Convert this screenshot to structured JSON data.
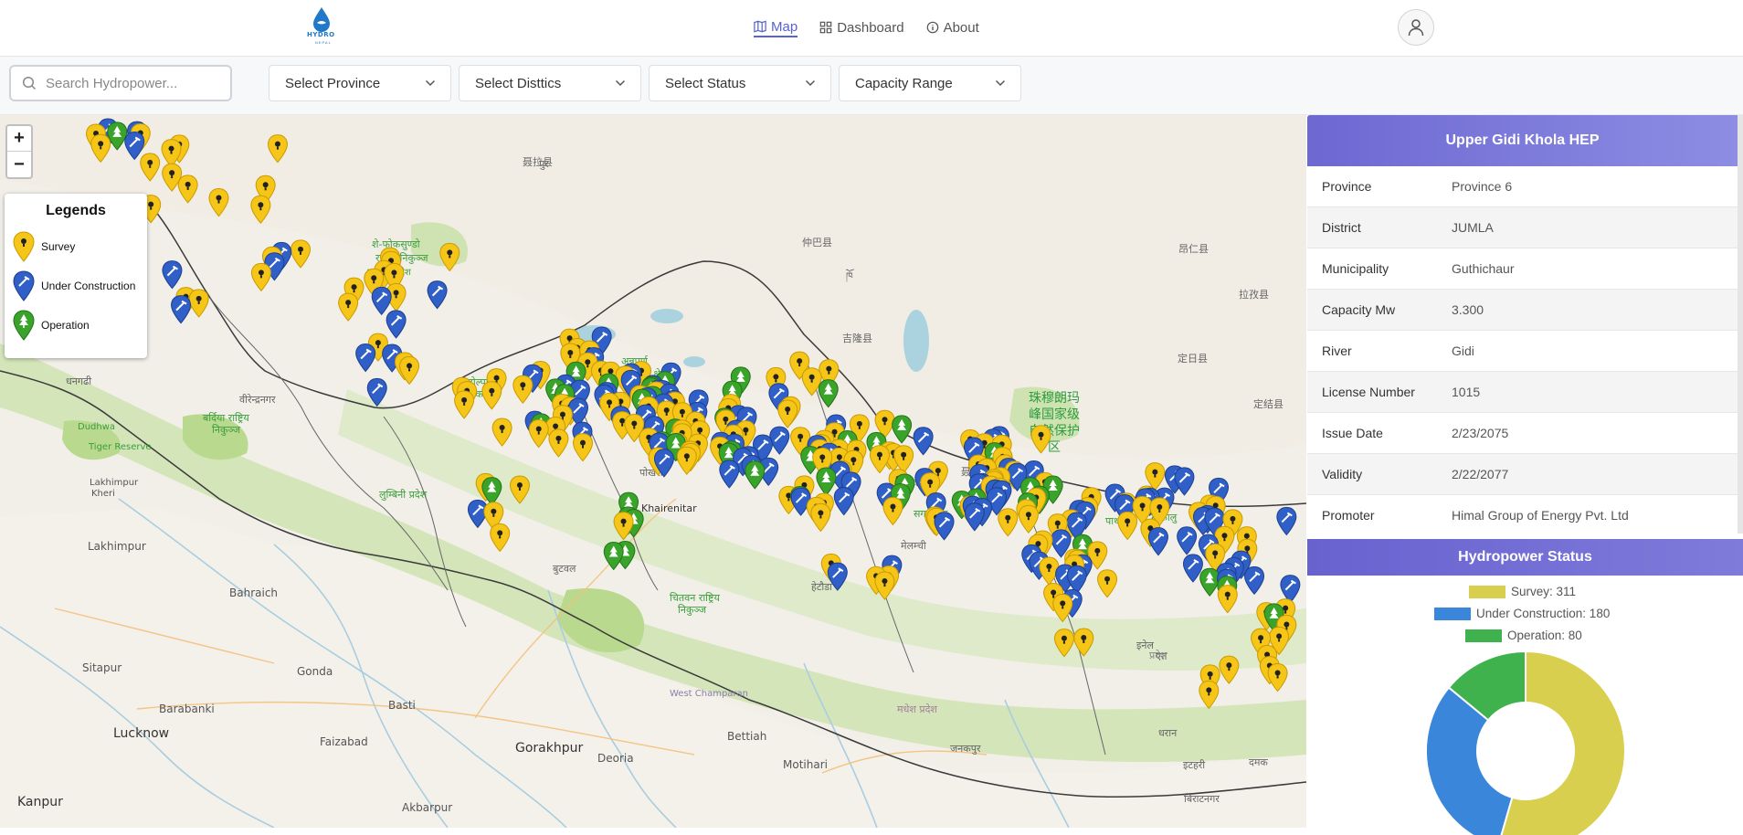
{
  "header": {
    "logo_text": "HYDRO",
    "logo_sub": "NEPAL",
    "nav": [
      {
        "label": "Map",
        "active": true
      },
      {
        "label": "Dashboard",
        "active": false
      },
      {
        "label": "About",
        "active": false
      }
    ]
  },
  "filters": {
    "search_placeholder": "Search Hydropower...",
    "province": "Select Province",
    "districts": "Select Disttics",
    "status": "Select Status",
    "capacity": "Capacity Range"
  },
  "map": {
    "zoom_in": "+",
    "zoom_out": "−",
    "legend": {
      "title": "Legends",
      "items": [
        {
          "label": "Survey",
          "color": "#f5c518"
        },
        {
          "label": "Under Construction",
          "color": "#2f5fc7"
        },
        {
          "label": "Operation",
          "color": "#3aa32a"
        }
      ]
    },
    "labels": {
      "lucknow": "Lucknow",
      "kanpur": "Kanpur",
      "gorakhpur": "Gorakhpur",
      "bettiah": "Bettiah",
      "west_champaran": "West Champaran",
      "lakhimpur": "Lakhimpur",
      "bahraich": "Bahraich",
      "sitapur": "Sitapur",
      "gonda": "Gonda",
      "basti": "Basti",
      "faizabad": "Faizabad",
      "barabanki": "Barabanki",
      "deoria": "Deoria",
      "motihari": "Motihari",
      "akbarpur": "Akbarpur",
      "reserve_cn": "珠穆朗玛\n峰国家级\n自然保护\n区",
      "dudhwa": "Dudhwa\nTiger Reserve",
      "khairenitar": "Khairenitar",
      "lakhimpur_kheri": "Lakhimpur\nKheri"
    }
  },
  "details": {
    "title": "Upper Gidi Khola HEP",
    "rows": [
      {
        "key": "Province",
        "value": "Province 6"
      },
      {
        "key": "District",
        "value": "JUMLA"
      },
      {
        "key": "Municipality",
        "value": "Guthichaur"
      },
      {
        "key": "Capacity Mw",
        "value": "3.300"
      },
      {
        "key": "River",
        "value": "Gidi"
      },
      {
        "key": "License Number",
        "value": "1015"
      },
      {
        "key": "Issue Date",
        "value": "2/23/2075"
      },
      {
        "key": "Validity",
        "value": "2/22/2077"
      },
      {
        "key": "Promoter",
        "value": "Himal Group of Energy Pvt. Ltd"
      }
    ]
  },
  "status": {
    "title": "Hydropower Status",
    "legend": [
      {
        "label": "Survey: 311",
        "color": "#d9cf4e"
      },
      {
        "label": "Under Construction: 180",
        "color": "#3a86db"
      },
      {
        "label": "Operation: 80",
        "color": "#3fb14d"
      }
    ],
    "chart_data": {
      "type": "pie",
      "categories": [
        "Survey",
        "Under Construction",
        "Operation"
      ],
      "values": [
        311,
        180,
        80
      ],
      "colors": [
        "#d9cf4e",
        "#3a86db",
        "#3fb14d"
      ]
    }
  }
}
